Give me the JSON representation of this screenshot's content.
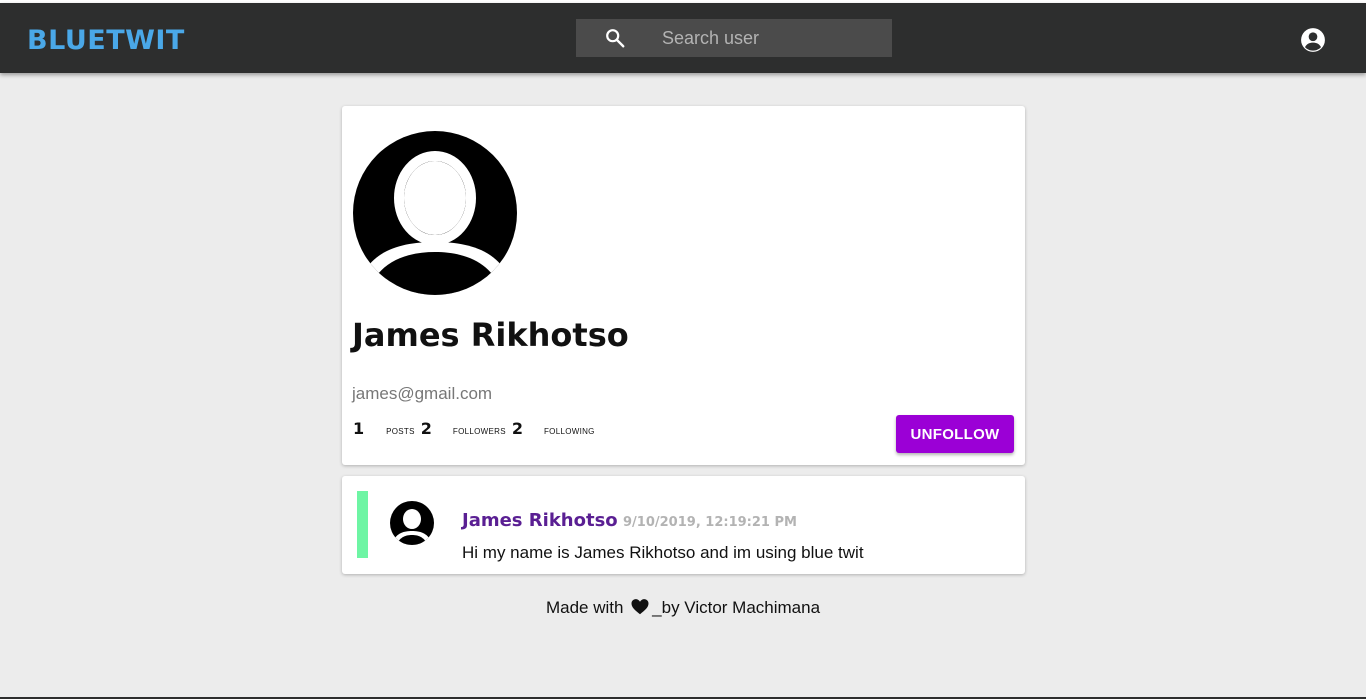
{
  "header": {
    "brand": "BLUETWIT",
    "search_placeholder": "Search user",
    "icons": {
      "search": "search-icon",
      "account": "account-circle-icon"
    }
  },
  "profile": {
    "name": "James Rikhotso",
    "email": "james@gmail.com",
    "posts_count": "1",
    "posts_label": "posts",
    "followers_count": "2",
    "followers_label": "followers",
    "following_count": "2",
    "following_label": "following",
    "unfollow_label": "UNFOLLOW",
    "avatar_icon": "default-user-avatar-icon"
  },
  "posts": [
    {
      "author": "James Rikhotso",
      "timestamp": "9/10/2019, 12:19:21 PM",
      "text": "Hi my name is James Rikhotso and im using blue twit",
      "accent": "#6ef5a4"
    }
  ],
  "footer": {
    "prefix": "Made with",
    "suffix": "_by Victor Machimana",
    "heart_icon": "heart-icon"
  },
  "colors": {
    "brand": "#4aa8e8",
    "header_bg": "#2d2e2e",
    "button": "#9b00d6",
    "author": "#5a1f93",
    "page_bg": "#ececec"
  }
}
